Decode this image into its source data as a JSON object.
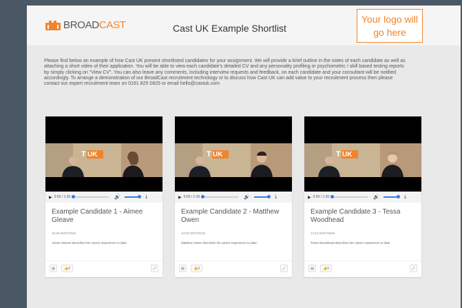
{
  "header": {
    "brand_part1": "BROAD",
    "brand_part2": "CAST",
    "title": "Cast UK Example Shortlist",
    "logo_placeholder": "Your logo will go here"
  },
  "intro": "Please find below an example of how Cast UK present shortlisted candidates for your assignment. We will provide a brief outline in the notes of each candidate as well as attaching a short video of their application. You will be able to view each candidate's detailed CV and any personality profiling or psychometric / skill based testing reports by simply clicking on \"View CV\". You can also leave any comments, including interview requests and feedback, on each candidate and your consultant will be notified accordingly. To arrange a demonstration of our BroadCast recruitment technology or to discuss how Cast UK can add value to your recruitment process then please contact our expert recruitment team on 0161 825 0825 or email hello@castuk.com",
  "player": {
    "time": "0:00 / 1:30"
  },
  "candidates": [
    {
      "name": "Example Candidate 1 - Aimee Gleave",
      "date": "15:35 04/07/2016",
      "description": "Aimee Gleave describes her career experience to date.",
      "like_label": "0"
    },
    {
      "name": "Example Candidate 2 - Matthew Owen",
      "date": "14:33 04/07/2016",
      "description": "Matthew Owen describes his career experience to date.",
      "like_label": "0"
    },
    {
      "name": "Example Candidate 3 - Tessa Woodhead",
      "date": "14:23 04/07/2016",
      "description": "Tessa Woodhead describes her career experience to date.",
      "like_label": "0"
    }
  ],
  "icons": {
    "play": "play-icon",
    "volume": "volume-icon",
    "download": "download-icon",
    "cv": "cv-icon",
    "like": "thumbs-up-icon",
    "expand": "expand-icon"
  },
  "colors": {
    "accent": "#f0842c",
    "seek": "#2f7de1",
    "background": "#4a5866"
  }
}
